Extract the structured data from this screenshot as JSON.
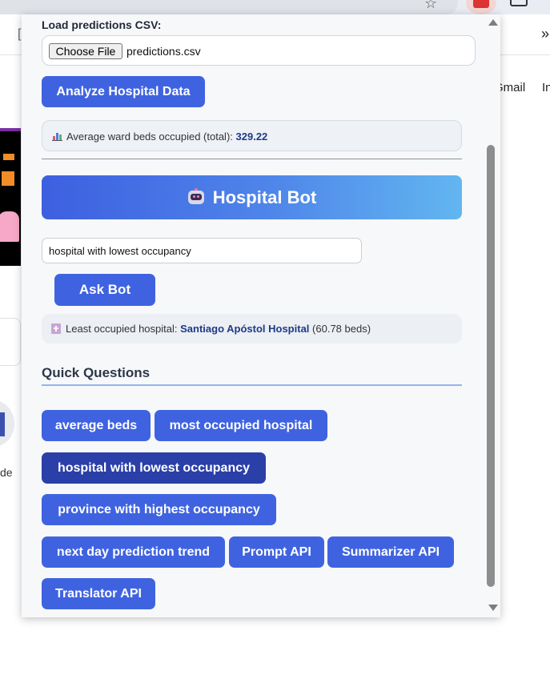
{
  "background": {
    "gmail_link": "Gmail",
    "images_link_partial": "In",
    "side_text_partial": "de"
  },
  "popup": {
    "file_section": {
      "label": "Load predictions CSV:",
      "choose_button": "Choose File",
      "file_name": "predictions.csv"
    },
    "analyze_button": "Analyze Hospital Data",
    "analysis_result": {
      "icon": "bar-chart-icon",
      "text": "Average ward beds occupied (total):",
      "value": "329.22"
    },
    "bot": {
      "icon": "robot-icon",
      "title": "Hospital Bot",
      "query_value": "hospital with lowest occupancy",
      "ask_button": "Ask Bot",
      "answer": {
        "icon": "hospital-icon",
        "prefix": "Least occupied hospital:",
        "hospital": "Santiago Apóstol Hospital",
        "suffix": "(60.78 beds)"
      }
    },
    "quick_questions": {
      "title": "Quick Questions",
      "items": [
        {
          "label": "average beds",
          "active": false
        },
        {
          "label": "most occupied hospital",
          "active": false
        },
        {
          "label": "hospital with lowest occupancy",
          "active": true
        },
        {
          "label": "province with highest occupancy",
          "active": false
        },
        {
          "label": "next day prediction trend",
          "active": false
        },
        {
          "label": "Prompt API",
          "active": false
        },
        {
          "label": "Summarizer API",
          "active": false
        },
        {
          "label": "Translator API",
          "active": false
        }
      ]
    }
  },
  "colors": {
    "primary_button": "#3f63e0",
    "active_button": "#2a3fa8",
    "highlight_text": "#1e3a8a",
    "header_gradient_start": "#3d5fe0",
    "header_gradient_end": "#62b6f0"
  }
}
